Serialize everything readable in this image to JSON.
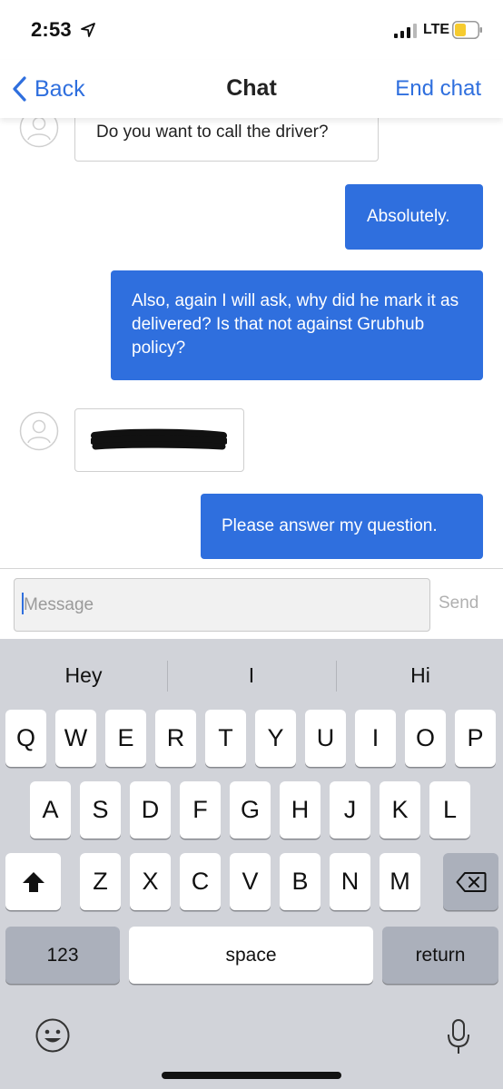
{
  "status_bar": {
    "time": "2:53",
    "network": "LTE"
  },
  "nav": {
    "back_label": "Back",
    "title": "Chat",
    "end_chat_label": "End chat"
  },
  "messages": [
    {
      "from": "agent",
      "text": "Do you want to call the driver?"
    },
    {
      "from": "user",
      "text": "Absolutely."
    },
    {
      "from": "user",
      "text": "Also, again I will ask, why did he mark it as delivered? Is that not against Grubhub policy?"
    },
    {
      "from": "agent",
      "text": ""
    },
    {
      "from": "user",
      "text": "Please answer my question."
    }
  ],
  "composer": {
    "placeholder": "Message",
    "value": "",
    "send_label": "Send"
  },
  "keyboard": {
    "suggestions": [
      "Hey",
      "I",
      "Hi"
    ],
    "row1": [
      "Q",
      "W",
      "E",
      "R",
      "T",
      "Y",
      "U",
      "I",
      "O",
      "P"
    ],
    "row2": [
      "A",
      "S",
      "D",
      "F",
      "G",
      "H",
      "J",
      "K",
      "L"
    ],
    "row3": [
      "Z",
      "X",
      "C",
      "V",
      "B",
      "N",
      "M"
    ],
    "numbers_label": "123",
    "space_label": "space",
    "return_label": "return"
  },
  "colors": {
    "accent": "#2f6fde",
    "keyboard_bg": "#d1d3d9",
    "dark_key": "#abb0bb"
  }
}
